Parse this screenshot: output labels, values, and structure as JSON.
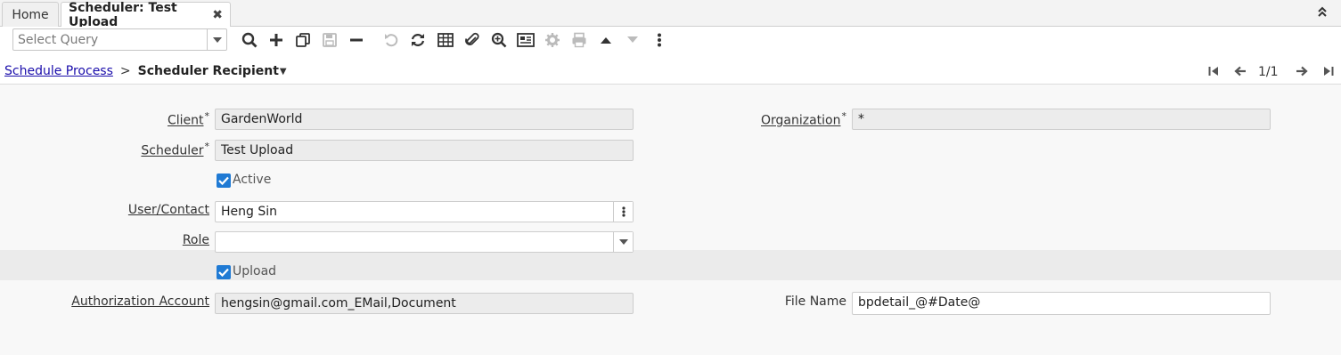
{
  "tabs": [
    {
      "label": "Home"
    },
    {
      "label": "Scheduler: Test Upload",
      "close": "✖"
    }
  ],
  "collapse_icon": "double-chevron-up",
  "toolbar": {
    "query_placeholder": "Select Query",
    "icons": [
      "search",
      "new",
      "copy",
      "save",
      "delete",
      "undo",
      "refresh",
      "grid-toggle",
      "attachment",
      "zoom",
      "report",
      "process",
      "print",
      "previous-record",
      "next-record",
      "more"
    ]
  },
  "breadcrumb": {
    "parent": "Schedule Process",
    "separator": ">",
    "current": "Scheduler Recipient"
  },
  "navigation": {
    "record_count": "1/1"
  },
  "form": {
    "client": {
      "label": "Client",
      "required": "*",
      "value": "GardenWorld"
    },
    "organization": {
      "label": "Organization",
      "required": "*",
      "value": "*"
    },
    "scheduler": {
      "label": "Scheduler",
      "required": "*",
      "value": "Test Upload"
    },
    "active": {
      "label": "Active",
      "checked": true
    },
    "user_contact": {
      "label": "User/Contact",
      "value": "Heng Sin"
    },
    "role": {
      "label": "Role",
      "value": ""
    },
    "upload": {
      "label": "Upload",
      "checked": true
    },
    "authorization_account": {
      "label": "Authorization Account",
      "value": "hengsin@gmail.com_EMail,Document"
    },
    "file_name": {
      "label": "File Name",
      "value": "bpdetail_@#Date@"
    }
  },
  "colors": {
    "link": "#1a0dab",
    "checkbox": "#1f7ad4",
    "readonly_field": "#ececec"
  }
}
